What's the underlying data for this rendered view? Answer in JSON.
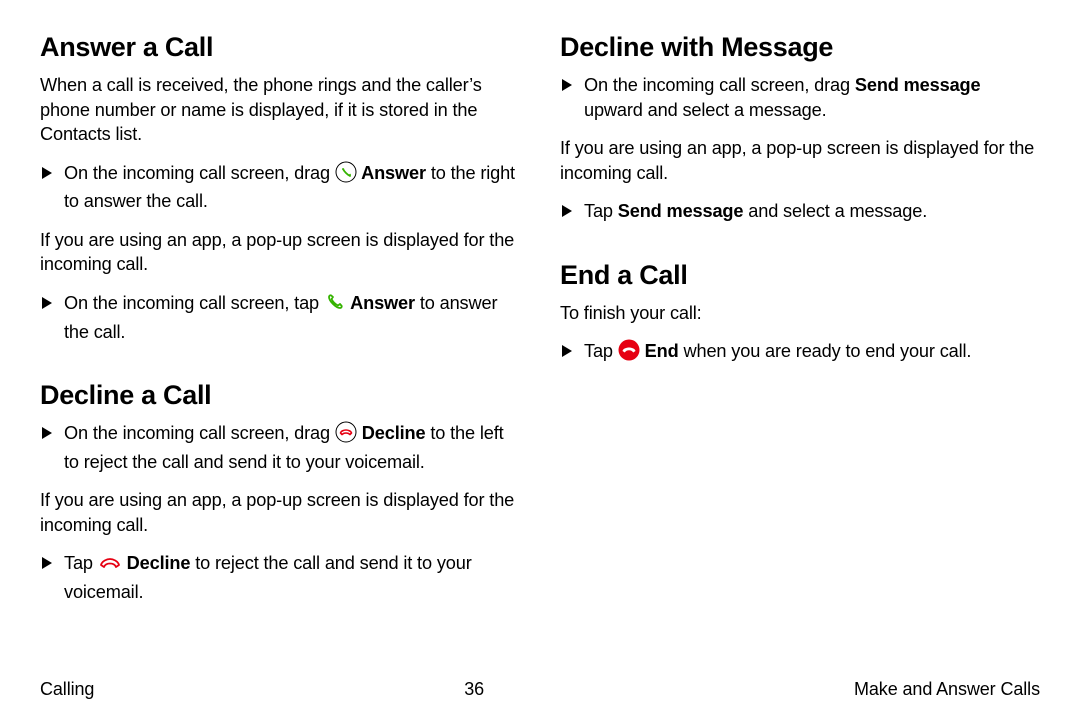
{
  "left": {
    "sec1": {
      "heading": "Answer a Call",
      "para1": "When a call is received, the phone rings and the caller’s phone number or name is displayed, if it is stored in the Contacts list.",
      "step1_a": "On the incoming call screen, drag ",
      "step1_b": " Answer",
      "step1_c": " to the right to answer the call.",
      "para2": "If you are using an app, a pop-up screen is displayed for the incoming call.",
      "step2_a": "On the incoming call screen, tap ",
      "step2_b": " Answer",
      "step2_c": " to answer the call."
    },
    "sec2": {
      "heading": "Decline a Call",
      "step1_a": "On the incoming call screen, drag ",
      "step1_b": " Decline",
      "step1_c": " to the left to reject the call and send it to your voicemail.",
      "para1": "If you are using an app, a pop-up screen is displayed for the incoming call.",
      "step2_a": "Tap ",
      "step2_b": " Decline",
      "step2_c": " to reject the call and send it to your voicemail."
    }
  },
  "right": {
    "sec1": {
      "heading": "Decline with Message",
      "step1_a": "On the incoming call screen, drag ",
      "step1_b": "Send message",
      "step1_c": " upward and select a message.",
      "para1": "If you are using an app, a pop-up screen is displayed for the incoming call.",
      "step2_a": "Tap ",
      "step2_b": "Send message",
      "step2_c": " and select a message."
    },
    "sec2": {
      "heading": "End a Call",
      "para1": "To finish your call:",
      "step1_a": "Tap ",
      "step1_b": " End",
      "step1_c": " when you are ready to end your call."
    }
  },
  "footer": {
    "left": "Calling",
    "center": "36",
    "right": "Make and Answer Calls"
  }
}
